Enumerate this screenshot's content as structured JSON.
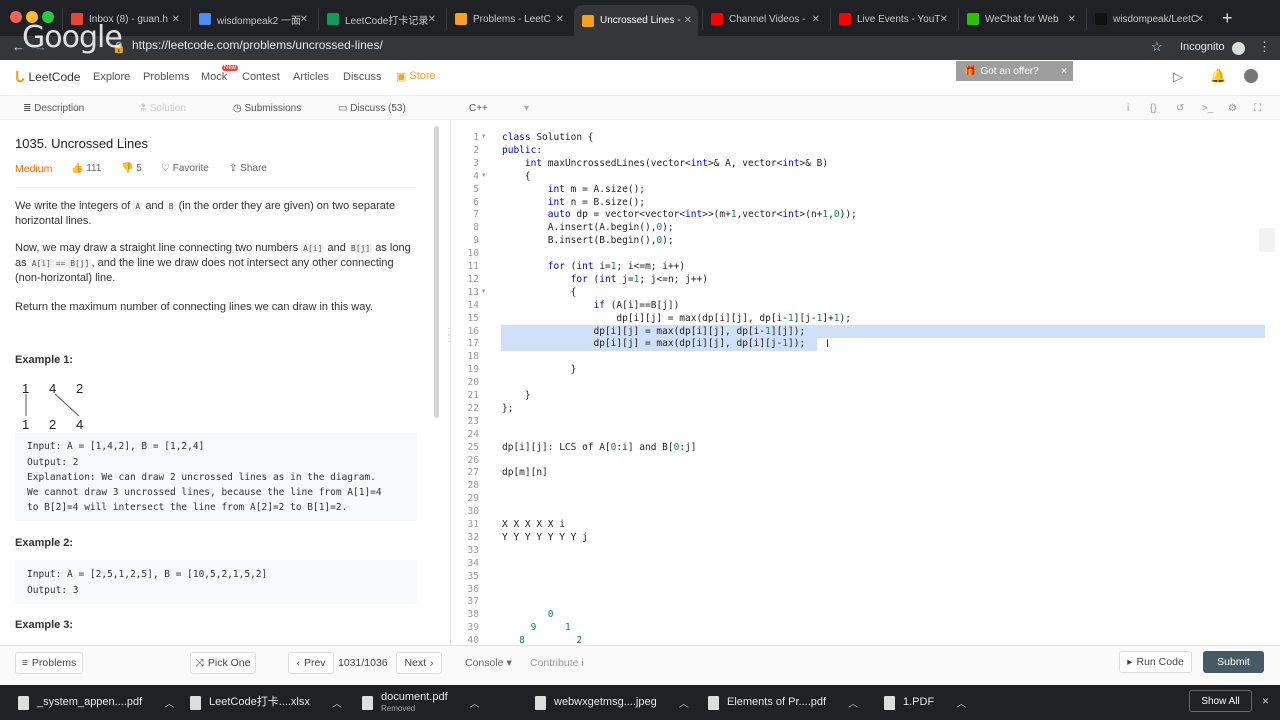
{
  "browser": {
    "tabs": [
      {
        "title": "Inbox (8) - guan.h",
        "color": "#ea4335"
      },
      {
        "title": "wisdompeak2 一面",
        "color": "#4c8bf5"
      },
      {
        "title": "LeetCode打卡记录",
        "color": "#0f9d58"
      },
      {
        "title": "Problems - LeetC",
        "color": "#f89f1b"
      },
      {
        "title": "Uncrossed Lines -",
        "color": "#f89f1b"
      },
      {
        "title": "Channel Videos -",
        "color": "#ff0000"
      },
      {
        "title": "Live Events - YouT",
        "color": "#ff0000"
      },
      {
        "title": "WeChat for Web",
        "color": "#2dc100"
      },
      {
        "title": "wisdompeak/LeetC",
        "color": "#111111"
      }
    ],
    "url": "https://leetcode.com/problems/uncrossed-lines/",
    "incognito_label": "Incognito",
    "watermark": "Google"
  },
  "nav": {
    "logo": "LeetCode",
    "links": [
      "Explore",
      "Problems",
      "Mock",
      "Contest",
      "Articles",
      "Discuss",
      "Store"
    ],
    "new_badge": "New",
    "offer": "Got an offer?"
  },
  "subtabs": {
    "description": "Description",
    "solution": "Solution",
    "submissions": "Submissions",
    "discuss": "Discuss (53)",
    "language": "C++"
  },
  "problem": {
    "title": "1035. Uncrossed Lines",
    "difficulty": "Medium",
    "likes": "111",
    "dislikes": "5",
    "favorite": "Favorite",
    "share": "Share",
    "p1a": "We write the integers of",
    "p1b": "and",
    "p1c": "(in the order they are given) on two separate horizontal lines.",
    "p2a": "Now, we may draw a straight line connecting two numbers",
    "p2b": "and",
    "p2c": "as long as",
    "p2d": ", and the line we draw does not intersect any other connecting (non-horizontal) line.",
    "code_A": "A",
    "code_B": "B",
    "code_Ai": "A[i]",
    "code_Bj": "B[j]",
    "code_eq": "A[i] == B[j]",
    "p3": "Return the maximum number of connecting lines we can draw in this way.",
    "ex1_title": "Example 1:",
    "ex1_top": [
      "1",
      "4",
      "2"
    ],
    "ex1_bottom": [
      "1",
      "2",
      "4"
    ],
    "ex1_input": "Input: A = [1,4,2], B = [1,2,4]",
    "ex1_output": "Output: 2",
    "ex1_expl1": "Explanation: We can draw 2 uncrossed lines as in the diagram.",
    "ex1_expl2": "We cannot draw 3 uncrossed lines, because the line from A[1]=4",
    "ex1_expl3": "to B[2]=4 will intersect the line from A[2]=2 to B[1]=2.",
    "ex2_title": "Example 2:",
    "ex2_input": "Input: A = [2,5,1,2,5], B = [10,5,2,1,5,2]",
    "ex2_output": "Output: 3",
    "ex3_title": "Example 3:"
  },
  "editor": {
    "lines": [
      "class Solution {",
      "public:",
      "    int maxUncrossedLines(vector<int>& A, vector<int>& B)",
      "    {",
      "        int m = A.size();",
      "        int n = B.size();",
      "        auto dp = vector<vector<int>>(m+1,vector<int>(n+1,0));",
      "        A.insert(A.begin(),0);",
      "        B.insert(B.begin(),0);",
      "",
      "        for (int i=1; i<=m; i++)",
      "            for (int j=1; j<=n; j++)",
      "            {",
      "                if (A[i]==B[j])",
      "                    dp[i][j] = max(dp[i][j], dp[i-1][j-1]+1);",
      "                dp[i][j] = max(dp[i][j], dp[i-1][j]);",
      "                dp[i][j] = max(dp[i][j], dp[i][j-1]);",
      "",
      "            }",
      "",
      "    }",
      "};",
      "",
      "",
      "dp[i][j]: LCS of A[0:i] and B[0:j]",
      "",
      "dp[m][n]",
      "",
      "",
      "",
      "X X X X X i",
      "Y Y Y Y Y Y Y j",
      "",
      "",
      "",
      "",
      "",
      "        0",
      "     9     1",
      "   8         2"
    ]
  },
  "bottom": {
    "problems": "Problems",
    "pick": "Pick One",
    "prev": "Prev",
    "counter": "1031/1036",
    "next": "Next",
    "console": "Console",
    "contribute": "Contribute",
    "run": "Run Code",
    "submit": "Submit"
  },
  "downloads": {
    "items": [
      {
        "name": "_system_appen....pdf",
        "sub": ""
      },
      {
        "name": "LeetCode打卡....xlsx",
        "sub": ""
      },
      {
        "name": "document.pdf",
        "sub": "Removed"
      },
      {
        "name": "webwxgetmsg....jpeg",
        "sub": ""
      },
      {
        "name": "Elements of Pr....pdf",
        "sub": ""
      },
      {
        "name": "1.PDF",
        "sub": ""
      }
    ],
    "show_all": "Show All"
  },
  "colors": {
    "accent": "#f89f1b",
    "medium": "#ef6c00",
    "keyword": "#0000cc",
    "submit": "#455a64"
  }
}
